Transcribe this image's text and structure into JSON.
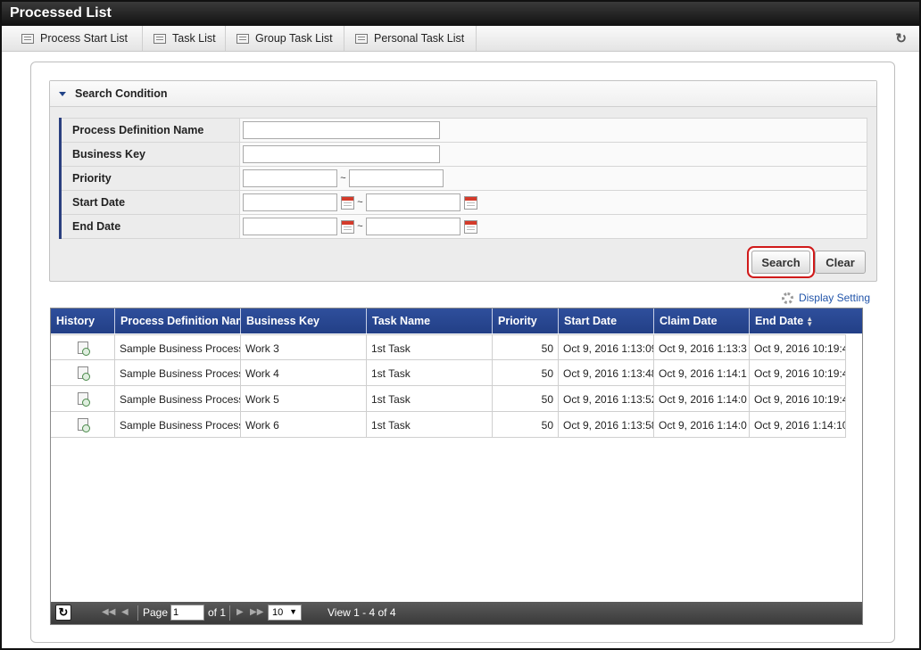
{
  "window": {
    "title": "Processed List"
  },
  "tabs": [
    {
      "label": "Process Start List"
    },
    {
      "label": "Task List"
    },
    {
      "label": "Group Task List"
    },
    {
      "label": "Personal Task List"
    }
  ],
  "search": {
    "header": "Search Condition",
    "fields": {
      "process_definition_name": {
        "label": "Process Definition Name",
        "value": ""
      },
      "business_key": {
        "label": "Business Key",
        "value": ""
      },
      "priority": {
        "label": "Priority",
        "from": "",
        "to": "",
        "separator": "~"
      },
      "start_date": {
        "label": "Start Date",
        "from": "",
        "to": "",
        "separator": "~"
      },
      "end_date": {
        "label": "End Date",
        "from": "",
        "to": "",
        "separator": "~"
      }
    },
    "search_button": "Search",
    "clear_button": "Clear"
  },
  "display_setting": "Display Setting",
  "grid": {
    "columns": [
      "History",
      "Process Definition Name",
      "Business Key",
      "Task Name",
      "Priority",
      "Start Date",
      "Claim Date",
      "End Date"
    ],
    "rows": [
      {
        "process": "Sample Business Process",
        "business_key": "Work 3",
        "task": "1st Task",
        "priority": "50",
        "start": "Oct 9, 2016 1:13:09",
        "claim": "Oct 9, 2016 1:13:3",
        "end": "Oct 9, 2016 10:19:4"
      },
      {
        "process": "Sample Business Process",
        "business_key": "Work 4",
        "task": "1st Task",
        "priority": "50",
        "start": "Oct 9, 2016 1:13:48",
        "claim": "Oct 9, 2016 1:14:1",
        "end": "Oct 9, 2016 10:19:4"
      },
      {
        "process": "Sample Business Process",
        "business_key": "Work 5",
        "task": "1st Task",
        "priority": "50",
        "start": "Oct 9, 2016 1:13:52",
        "claim": "Oct 9, 2016 1:14:0",
        "end": "Oct 9, 2016 10:19:4"
      },
      {
        "process": "Sample Business Process",
        "business_key": "Work 6",
        "task": "1st Task",
        "priority": "50",
        "start": "Oct 9, 2016 1:13:58",
        "claim": "Oct 9, 2016 1:14:0",
        "end": "Oct 9, 2016 1:14:10"
      }
    ],
    "pager": {
      "page_label": "Page",
      "page_value": "1",
      "of_label": "of 1",
      "rows_per_page": "10",
      "view_text": "View 1 - 4 of 4"
    }
  },
  "colors": {
    "header_blue": "#223f86",
    "titlebar": "#111111",
    "highlight": "#d01a1a"
  }
}
